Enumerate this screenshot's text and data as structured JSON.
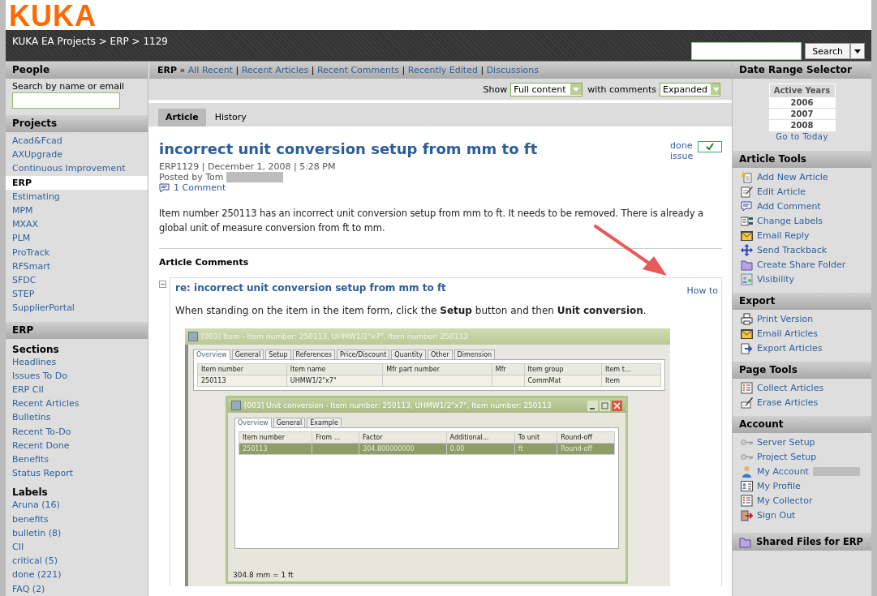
{
  "header": {
    "logo": "KUKA",
    "breadcrumb": "KUKA EA Projects > ERP > 1129",
    "search": {
      "button": "Search"
    }
  },
  "left_sidebar": {
    "people": {
      "title": "People",
      "label": "Search by name or email"
    },
    "projects": {
      "title": "Projects",
      "items": [
        {
          "label": "Acad&Fcad",
          "selected": false
        },
        {
          "label": "AXUpgrade",
          "selected": false
        },
        {
          "label": "Continuous Improvement",
          "selected": false
        },
        {
          "label": "ERP",
          "selected": true
        },
        {
          "label": "Estimating",
          "selected": false
        },
        {
          "label": "MPM",
          "selected": false
        },
        {
          "label": "MXAX",
          "selected": false
        },
        {
          "label": "PLM",
          "selected": false
        },
        {
          "label": "ProTrack",
          "selected": false
        },
        {
          "label": "RFSmart",
          "selected": false
        },
        {
          "label": "SFDC",
          "selected": false
        },
        {
          "label": "STEP",
          "selected": false
        },
        {
          "label": "SupplierPortal",
          "selected": false
        }
      ]
    },
    "erp": {
      "title": "ERP",
      "sections_title": "Sections",
      "sections": [
        "Headlines",
        "Issues To Do",
        "ERP CII",
        "Recent Articles",
        "Bulletins",
        "Recent To-Do",
        "Recent Done",
        "Benefits",
        "Status Report"
      ],
      "labels_title": "Labels",
      "labels": [
        "Aruna (16)",
        "benefits",
        "bulletin (8)",
        "CII",
        "critical (5)",
        "done (221)",
        "FAQ (2)"
      ]
    }
  },
  "content": {
    "nav": {
      "current": "ERP",
      "separator": "»",
      "divider": "|",
      "links": [
        "All Recent",
        "Recent Articles",
        "Recent Comments",
        "Recently Edited",
        "Discussions"
      ]
    },
    "options": {
      "show_label": "Show",
      "show_value": "Full content",
      "comments_label": "with comments",
      "comments_value": "Expanded"
    },
    "tabs": [
      {
        "label": "Article",
        "selected": true
      },
      {
        "label": "History",
        "selected": false
      }
    ],
    "article": {
      "title": "incorrect unit conversion setup from mm to ft",
      "meta": "ERP1129 | December 1, 2008 | 5:28 PM",
      "posted_by": "Posted by Tom",
      "comments": "1 Comment",
      "status": {
        "label": "done issue",
        "checked": true
      },
      "body": "Item number 250113 has an incorrect unit conversion setup from mm to ft. It needs to be removed. There is already a global unit of measure conversion from ft to mm.",
      "comments_heading": "Article Comments"
    },
    "comment": {
      "expanded": true,
      "title": "re: incorrect unit conversion setup from mm to ft",
      "tag": "How to",
      "body": "When standing on the item in the item form, click the **Setup** button and then **Unit conversion**.",
      "screenshot": {
        "title": "[003] Item - Item number: 250113, UHMW1/2\"x7\", Item number: 250113",
        "tabs": [
          {
            "label": "Overview",
            "selected": true
          },
          {
            "label": "General",
            "selected": false
          },
          {
            "label": "Setup",
            "selected": false
          },
          {
            "label": "References",
            "selected": false
          },
          {
            "label": "Price/Discount",
            "selected": false
          },
          {
            "label": "Quantity",
            "selected": false
          },
          {
            "label": "Other",
            "selected": false
          },
          {
            "label": "Dimension",
            "selected": false
          }
        ],
        "columns": [
          "Item number",
          "Item name",
          "Mfr part number",
          "Mfr",
          "Item group",
          "Item t..."
        ],
        "rows": [
          {
            "cells": [
              "250113",
              "UHMW1/2\"x7\"",
              null,
              null,
              "CommMat",
              "Item"
            ]
          }
        ],
        "dialog": {
          "title": "[003] Unit conversion - Item number: 250113, UHMW1/2\"x7\", Item number: 250113",
          "tabs": [
            {
              "label": "Overview",
              "selected": true
            },
            {
              "label": "General",
              "selected": false
            },
            {
              "label": "Example",
              "selected": false
            }
          ],
          "columns": [
            "Item number",
            "From ...",
            "Factor",
            "Additional...",
            "To unit",
            "Round-off"
          ],
          "rows": [
            {
              "cells": [
                "250113",
                null,
                "304.800000000",
                "0.00",
                "ft",
                "Round-off"
              ]
            }
          ],
          "footer": "304.8 mm = 1 ft"
        }
      }
    }
  },
  "right_sidebar": {
    "date_range": {
      "title": "Date Range Selector",
      "heading": "Active Years",
      "years": [
        "2006",
        "2007",
        "2008"
      ],
      "today": "Go to Today"
    },
    "panels": [
      {
        "title": "Article Tools",
        "items": [
          {
            "label": "Add New Article"
          },
          {
            "label": "Edit Article"
          },
          {
            "label": "Add Comment"
          },
          {
            "label": "Change Labels"
          },
          {
            "label": "Email Reply"
          },
          {
            "label": "Send Trackback"
          },
          {
            "label": "Create Share Folder"
          },
          {
            "label": "Visibility"
          }
        ]
      },
      {
        "title": "Export",
        "items": [
          {
            "label": "Print Version"
          },
          {
            "label": "Email Articles"
          },
          {
            "label": "Export Articles"
          }
        ]
      },
      {
        "title": "Page Tools",
        "items": [
          {
            "label": "Collect Articles"
          },
          {
            "label": "Erase Articles"
          }
        ]
      },
      {
        "title": "Account",
        "items": [
          {
            "label": "Server Setup",
            "redacted": false
          },
          {
            "label": "Project Setup",
            "redacted": false
          },
          {
            "label": "My Account",
            "redacted": true
          },
          {
            "label": "My Profile",
            "redacted": false
          },
          {
            "label": "My Collector",
            "redacted": false
          },
          {
            "label": "Sign Out",
            "redacted": false
          }
        ]
      }
    ],
    "shared_files": "Shared Files for ERP"
  }
}
